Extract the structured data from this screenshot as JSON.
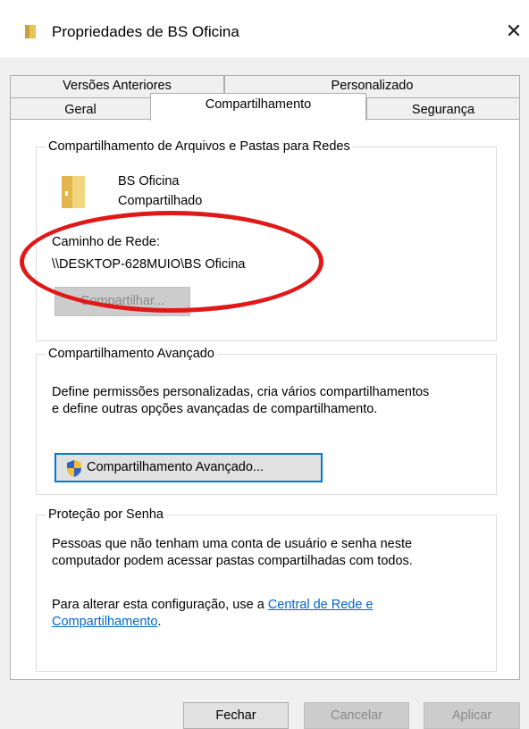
{
  "window": {
    "title": "Propriedades de BS Oficina",
    "close_glyph": "✕"
  },
  "tabs": {
    "row1": [
      {
        "label": "Versões Anteriores"
      },
      {
        "label": "Personalizado"
      }
    ],
    "row2": [
      {
        "label": "Geral"
      },
      {
        "label": "Compartilhamento",
        "active": true
      },
      {
        "label": "Segurança"
      }
    ]
  },
  "network_sharing": {
    "legend": "Compartilhamento de Arquivos e Pastas para Redes",
    "folder_name": "BS Oficina",
    "folder_status": "Compartilhado",
    "network_path_label": "Caminho de Rede:",
    "network_path": "\\\\DESKTOP-628MUIO\\BS Oficina",
    "share_button": "Compartilhar..."
  },
  "advanced_sharing": {
    "legend": "Compartilhamento Avançado",
    "description_line1": "Define permissões personalizadas, cria vários compartilhamentos",
    "description_line2": "e define outras opções avançadas de compartilhamento.",
    "button": "Compartilhamento Avançado..."
  },
  "password_protection": {
    "legend": "Proteção por Senha",
    "description_line1": "Pessoas que não tenham uma conta de usuário e senha neste",
    "description_line2": "computador podem acessar pastas compartilhadas com todos.",
    "change_text": "Para alterar esta configuração, use a ",
    "link_line1": "Central de Rede e",
    "link_line2": "Compartilhamento",
    "trailing_period": "."
  },
  "footer": {
    "close": "Fechar",
    "cancel": "Cancelar",
    "apply": "Aplicar"
  },
  "icons": [
    "folder-icon",
    "close-icon",
    "uac-shield-icon"
  ],
  "colors": {
    "accent": "#0078d7",
    "link": "#0066cc",
    "annotation": "#e01818",
    "folder": "#e8c25a"
  }
}
